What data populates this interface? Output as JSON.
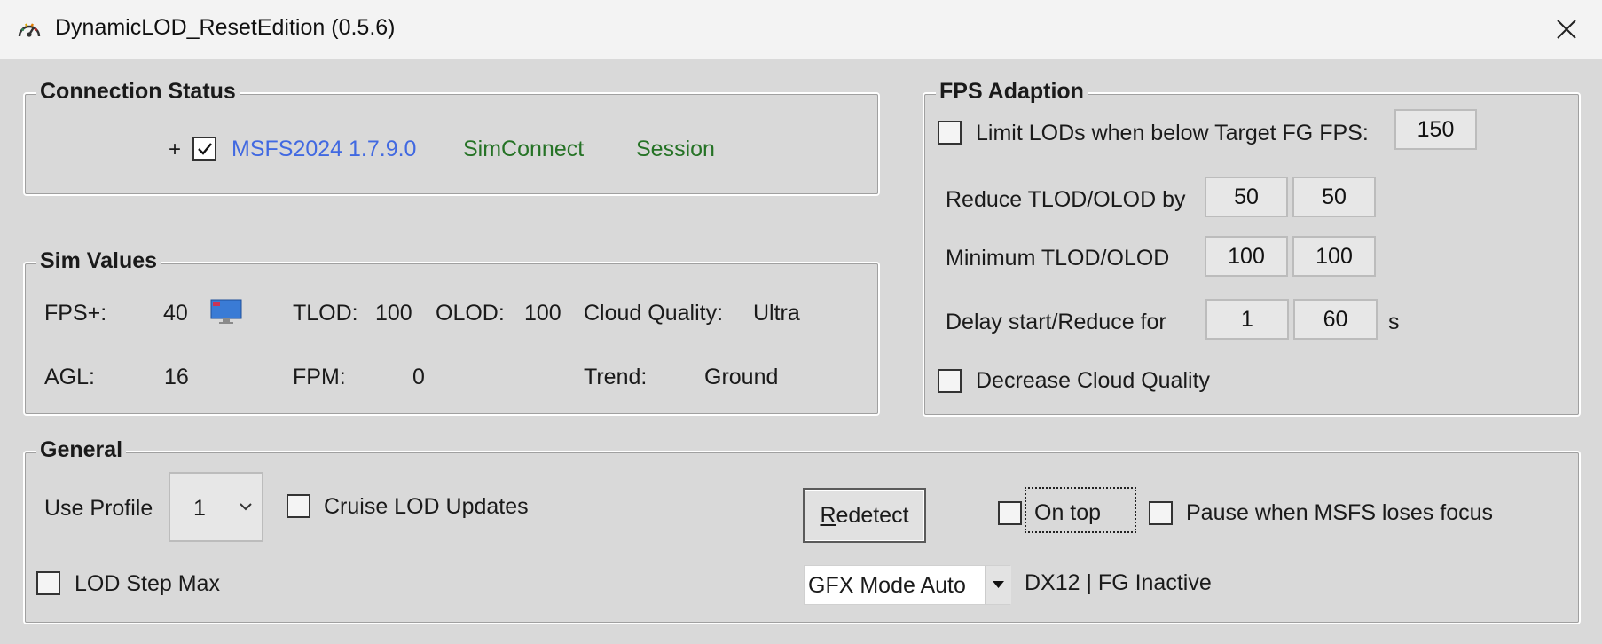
{
  "window": {
    "title": "DynamicLOD_ResetEdition (0.5.6)",
    "app_icon": "gauge-icon",
    "close_icon": "close-icon"
  },
  "connection": {
    "group_title": "Connection Status",
    "plus": "+",
    "msfs_checked": true,
    "msfs_version": "MSFS2024 1.7.9.0",
    "simconnect": "SimConnect",
    "session": "Session",
    "colors": {
      "msfs": "#4169e1",
      "status_ok": "#267326"
    }
  },
  "sim": {
    "group_title": "Sim Values",
    "fps_label": "FPS+:",
    "fps_value": "40",
    "monitor_icon": "monitor-icon",
    "tlod_label": "TLOD:",
    "tlod_value": "100",
    "olod_label": "OLOD:",
    "olod_value": "100",
    "cloud_label": "Cloud Quality:",
    "cloud_value": "Ultra",
    "agl_label": "AGL:",
    "agl_value": "16",
    "fpm_label": "FPM:",
    "fpm_value": "0",
    "trend_label": "Trend:",
    "trend_value": "Ground"
  },
  "fps": {
    "group_title": "FPS Adaption",
    "limit_label": "Limit LODs when below Target FG FPS:",
    "limit_checked": false,
    "target_fps": "150",
    "reduce_label": "Reduce TLOD/OLOD by",
    "reduce_tlod": "50",
    "reduce_olod": "50",
    "min_label": "Minimum TLOD/OLOD",
    "min_tlod": "100",
    "min_olod": "100",
    "delay_label": "Delay start/Reduce for",
    "delay_start": "1",
    "reduce_for": "60",
    "delay_unit": "s",
    "cloud_label": "Decrease Cloud Quality",
    "cloud_checked": false
  },
  "general": {
    "group_title": "General",
    "profile_label": "Use Profile",
    "profile_value": "1",
    "cruise_label": "Cruise LOD Updates",
    "cruise_checked": false,
    "redetect_accel": "R",
    "redetect_rest": "edetect",
    "ontop_label": "On top",
    "ontop_checked": false,
    "pause_label": "Pause when MSFS loses focus",
    "pause_checked": false,
    "lodstep_label": "LOD Step Max",
    "lodstep_checked": false,
    "gfx_value": "GFX Mode Auto",
    "status_text": "DX12 | FG Inactive"
  }
}
